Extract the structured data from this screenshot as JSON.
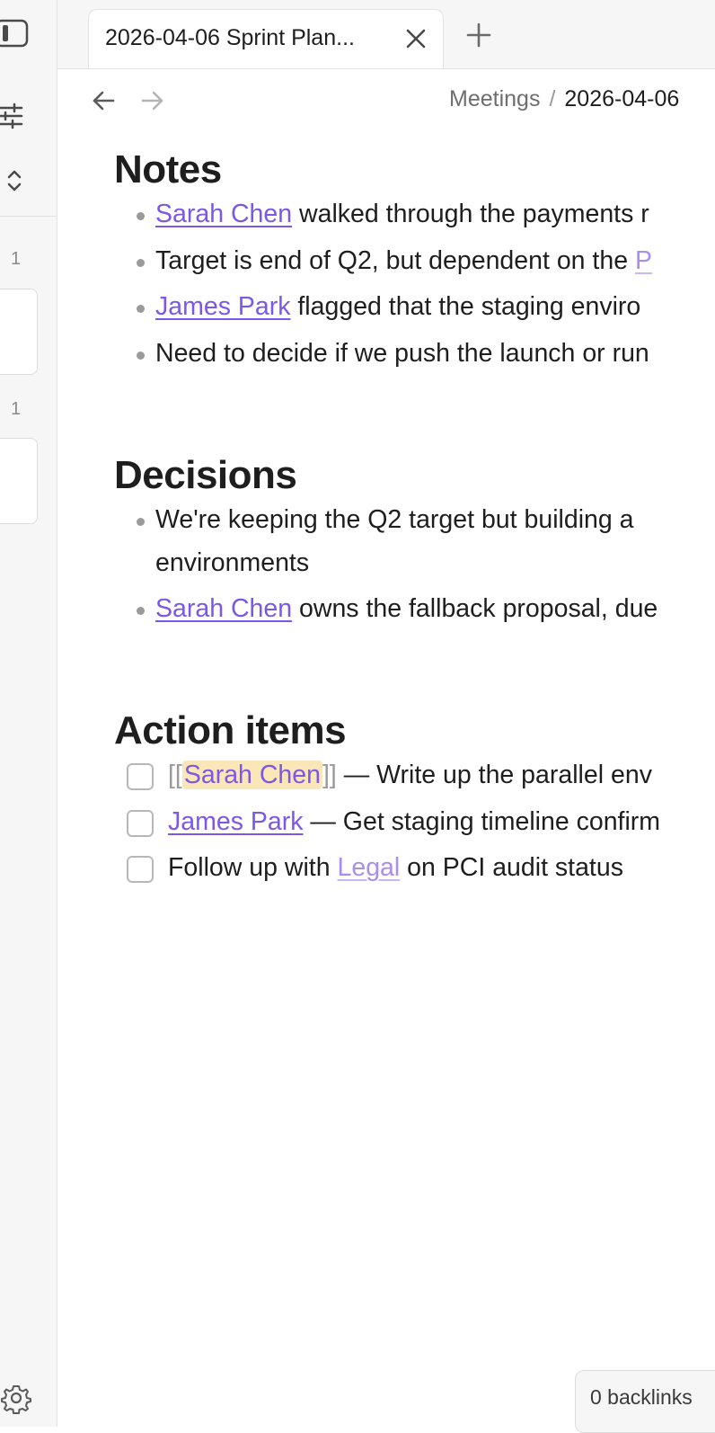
{
  "sidebar": {
    "groups": [
      {
        "count": "1"
      },
      {
        "count": "1"
      }
    ]
  },
  "tabs": [
    {
      "title": "2026-04-06 Sprint Plan...",
      "active": true
    }
  ],
  "breadcrumb": {
    "parent": "Meetings",
    "separator": "/",
    "current": "2026-04-06"
  },
  "note": {
    "sections": {
      "notes": {
        "heading": "Notes",
        "items": [
          {
            "link": "Sarah Chen",
            "text": " walked through the payments r"
          },
          {
            "text": "Target is end of Q2, but dependent on the ",
            "link_faint": "P"
          },
          {
            "link": "James Park",
            "text": " flagged that the staging enviro"
          },
          {
            "text": "Need to decide if we push the launch or run"
          }
        ]
      },
      "decisions": {
        "heading": "Decisions",
        "items": [
          {
            "text": "We're keeping the Q2 target but building a",
            "continuation": "environments"
          },
          {
            "link": "Sarah Chen",
            "text": " owns the fallback proposal, due"
          }
        ]
      },
      "action_items": {
        "heading": "Action items",
        "tasks": [
          {
            "bracket_open": "[[",
            "link": "Sarah Chen",
            "bracket_close": "]]",
            "text": " — Write up the parallel env",
            "checked": false
          },
          {
            "link": "James Park",
            "text": " — Get staging timeline confirm",
            "checked": false
          },
          {
            "prefix": "Follow up with ",
            "link": "Legal",
            "text": " on PCI audit status",
            "checked": false
          }
        ]
      }
    }
  },
  "status": {
    "backlinks": "0 backlinks"
  },
  "colors": {
    "accent": "#7c57e8",
    "highlight": "#fbe6b8",
    "sidebar_bg": "#f6f6f6"
  },
  "icons": {
    "sidebar_toggle": "sidebar-toggle-icon",
    "sliders": "sliders-icon",
    "sort": "chevron-up-down-icon",
    "close": "close-icon",
    "new_tab": "plus-icon",
    "back": "arrow-left-icon",
    "forward": "arrow-right-icon",
    "settings": "gear-icon"
  }
}
